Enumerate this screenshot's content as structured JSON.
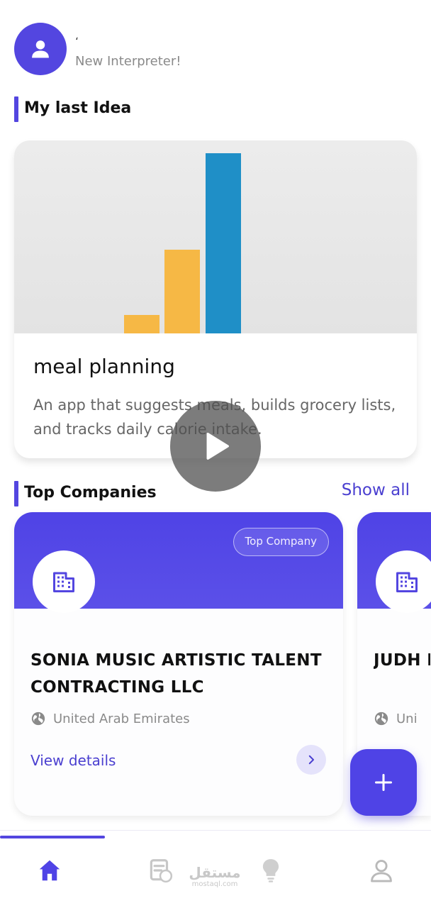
{
  "header": {
    "greeting": "،",
    "subtitle": "New Interpreter!"
  },
  "sections": {
    "last_idea": "My last Idea",
    "top_companies": "Top Companies",
    "show_all": "Show all"
  },
  "idea": {
    "title": "meal planning",
    "description": "An app that suggests meals, builds grocery lists, and tracks daily calorie intake."
  },
  "companies": [
    {
      "badge": "Top Company",
      "name": "SONIA MUSIC ARTISTIC TALENT CONTRACTING LLC",
      "location": "United Arab Emirates",
      "view_details": "View details"
    },
    {
      "name": "JUDH MARI",
      "location": "Uni"
    }
  ],
  "bottom_nav": {
    "items": [
      "home-icon",
      "clipboard-icon",
      "lightbulb-icon",
      "profile-icon"
    ],
    "active": "home-icon",
    "watermark_ar": "مستقل",
    "watermark_en": "mostaql.com"
  },
  "colors": {
    "accent": "#5346e0",
    "company_header": "#4f43e6",
    "link": "#4a3fd0",
    "bar_orange": "#f6b845",
    "bar_blue": "#1f8fc7"
  },
  "icons": {
    "avatar": "user-icon",
    "play": "play-icon",
    "company_logo": "building-icon",
    "location": "globe-icon",
    "arrow": "chevron-right-icon",
    "fab": "plus-icon"
  }
}
